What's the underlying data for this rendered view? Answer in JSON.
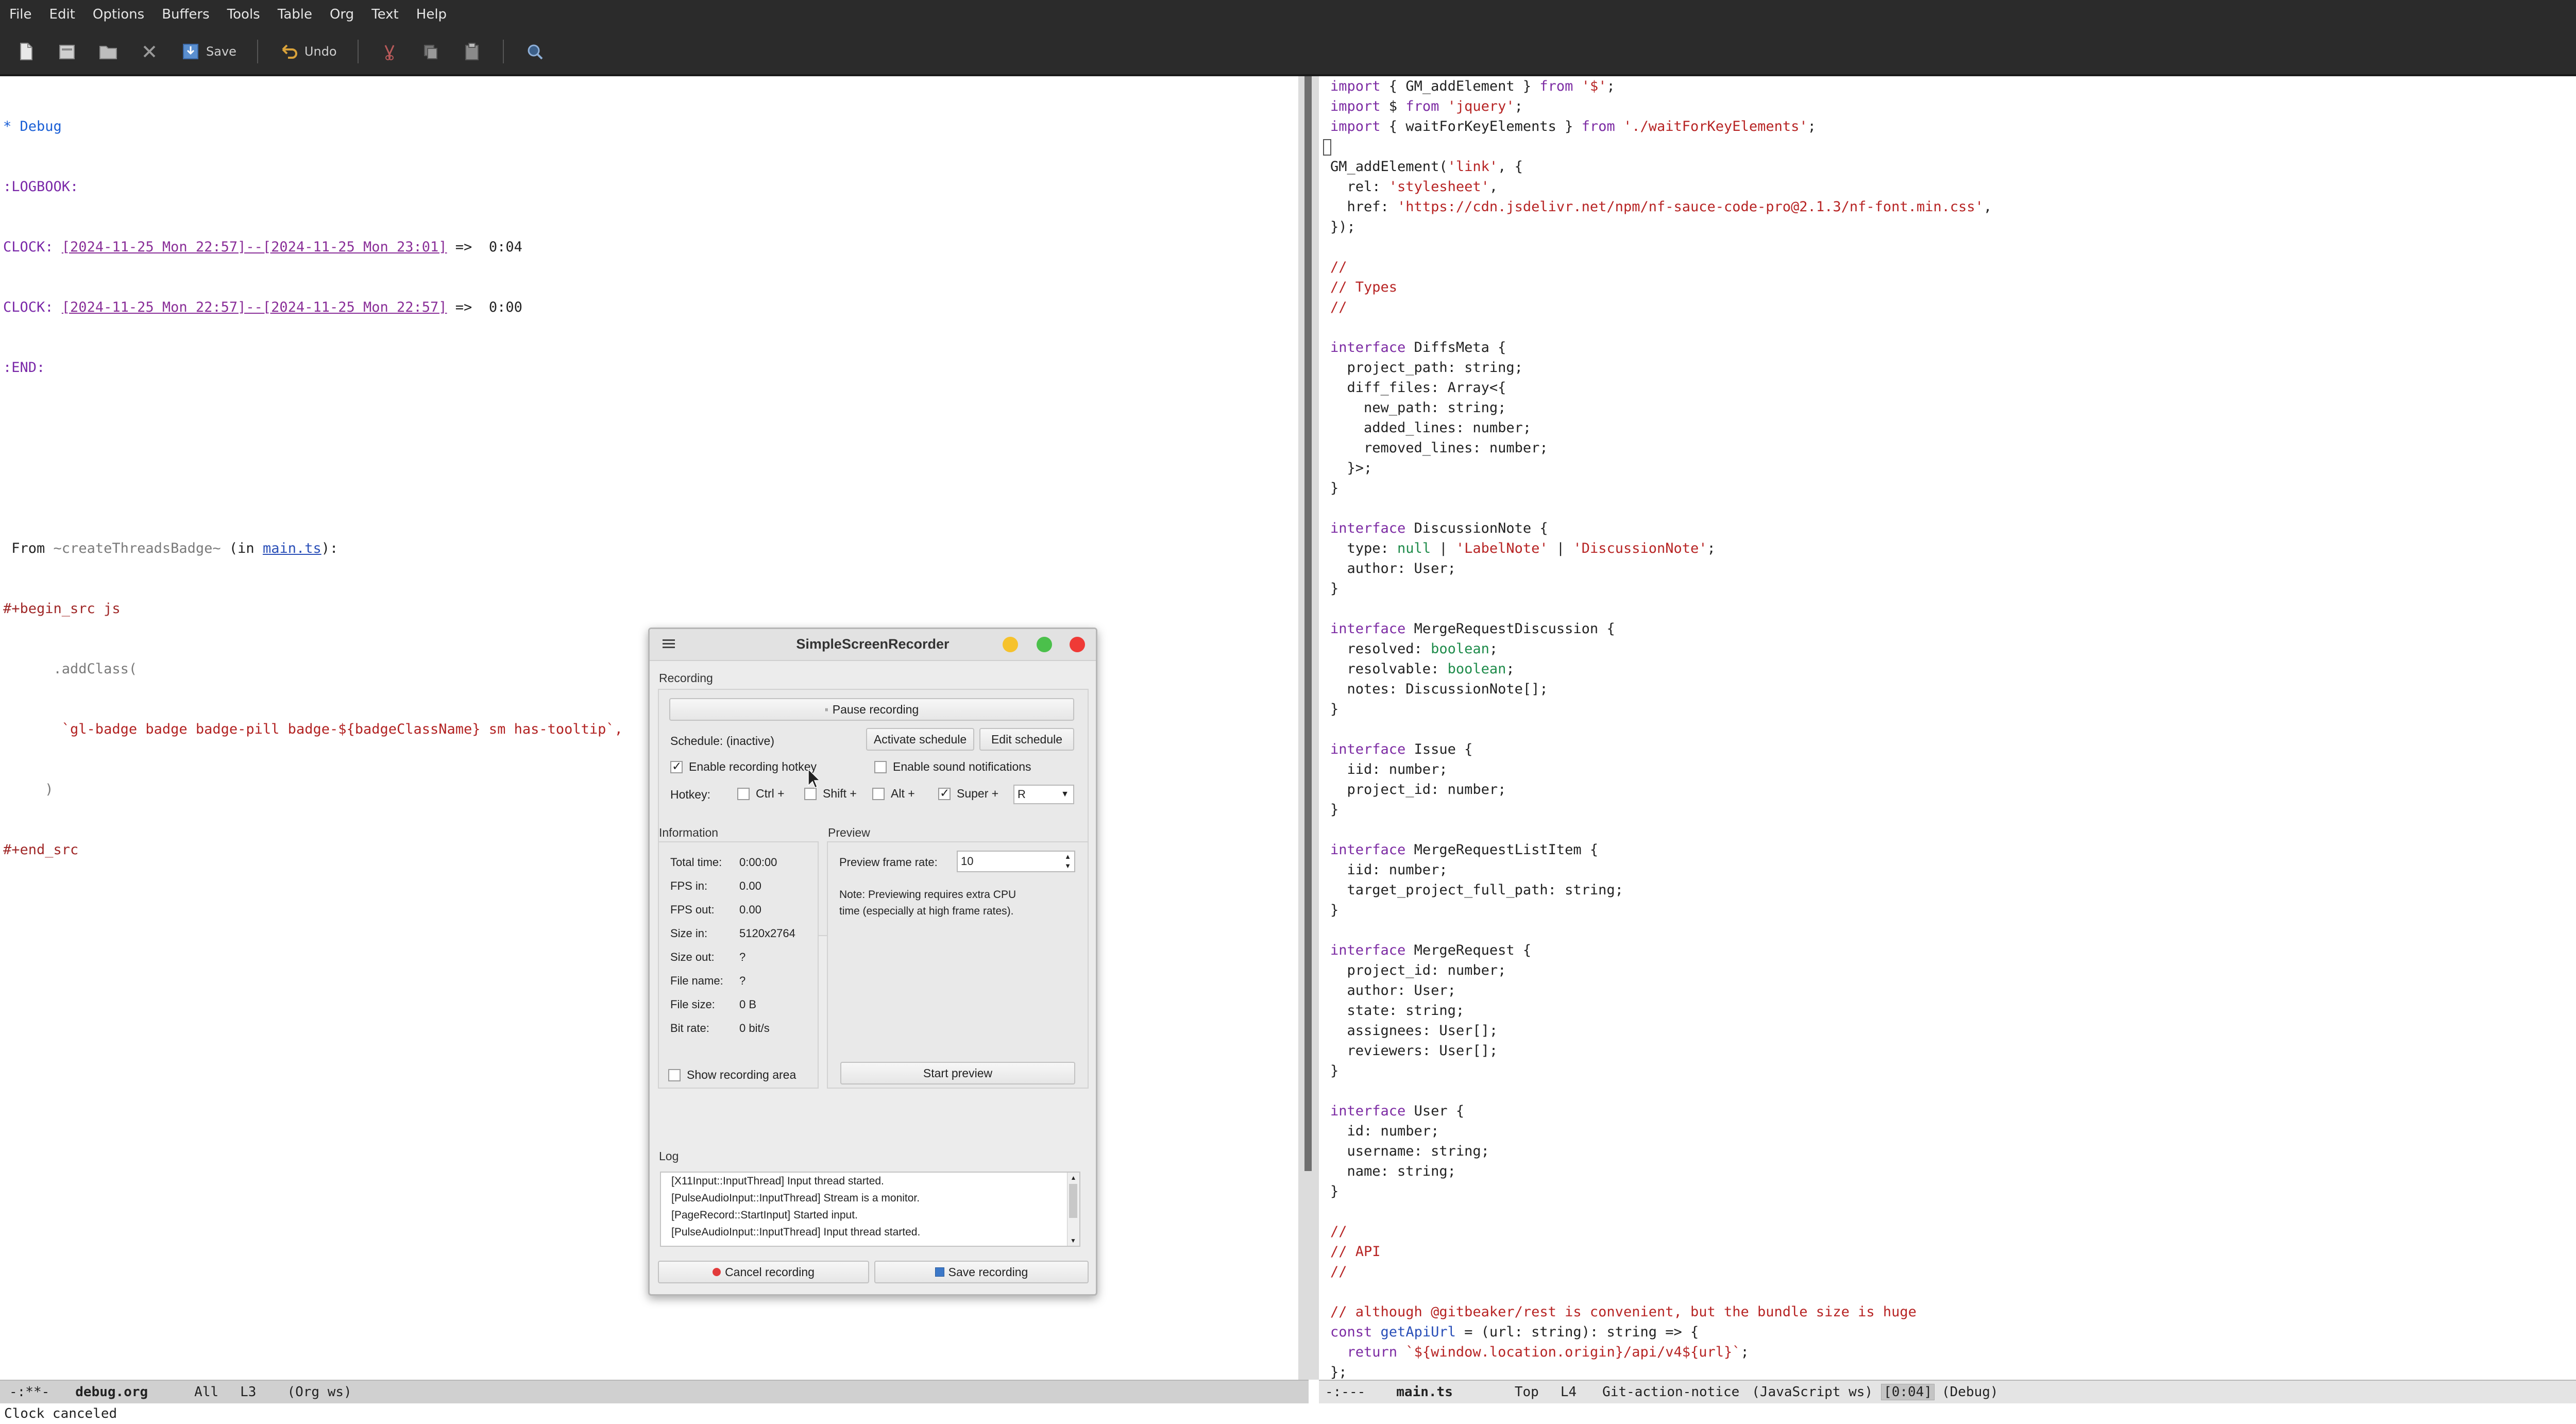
{
  "menubar": {
    "items": [
      "File",
      "Edit",
      "Options",
      "Buffers",
      "Tools",
      "Table",
      "Org",
      "Text",
      "Help"
    ]
  },
  "toolbar": {
    "save_label": "Save",
    "undo_label": "Undo",
    "icons": [
      "new-file-icon",
      "open-file-icon",
      "open-directory-icon",
      "close-icon",
      "save-icon",
      "undo-icon",
      "cut-icon",
      "copy-icon",
      "paste-icon",
      "search-icon"
    ]
  },
  "left_buffer": {
    "lines": {
      "l1": "* Debug",
      "l2": ":LOGBOOK:",
      "l3_pre": "CLOCK: ",
      "l3_ts": "[2024-11-25 Mon 22:57]--[2024-11-25 Mon 23:01]",
      "l3_post": " =>  0:04",
      "l4_pre": "CLOCK: ",
      "l4_ts": "[2024-11-25 Mon 22:57]--[2024-11-25 Mon 22:57]",
      "l4_post": " =>  0:00",
      "l5": ":END:",
      "l8_a": " From ",
      "l8_b": "~createThreadsBadge~",
      "l8_c": " (in ",
      "l8_d": "main.ts",
      "l8_e": "):",
      "l9": "#+begin_src js",
      "l10": "      .addClass(",
      "l11": "       `gl-badge badge badge-pill badge-${badgeClassName} sm has-tooltip`,",
      "l12": "     )",
      "l13": "#+end_src"
    }
  },
  "right_buffer": {
    "lines": [
      [
        "k:import",
        " { GM_addElement } ",
        "k:from",
        " ",
        "s:'$'",
        ";"
      ],
      [
        "k:import",
        " $ ",
        "k:from",
        " ",
        "s:'jquery'",
        ";"
      ],
      [
        "k:import",
        " { waitForKeyElements } ",
        "k:from",
        " ",
        "s:'./waitForKeyElements'",
        ";"
      ],
      [
        ""
      ],
      [
        "GM_addElement(",
        "s:'link'",
        ", {"
      ],
      [
        "  rel: ",
        "s:'stylesheet'",
        ","
      ],
      [
        "  href: ",
        "s:'https://cdn.jsdelivr.net/npm/nf-sauce-code-pro@2.1.3/nf-font.min.css'",
        ","
      ],
      [
        "});"
      ],
      [
        ""
      ],
      [
        "c://"
      ],
      [
        "c:// Types"
      ],
      [
        "c://"
      ],
      [
        ""
      ],
      [
        "k:interface",
        " DiffsMeta {"
      ],
      [
        "  project_path: string;"
      ],
      [
        "  diff_files: Array<{"
      ],
      [
        "    new_path: string;"
      ],
      [
        "    added_lines: number;"
      ],
      [
        "    removed_lines: number;"
      ],
      [
        "  }>;"
      ],
      [
        "}"
      ],
      [
        ""
      ],
      [
        "k:interface",
        " DiscussionNote {"
      ],
      [
        "  type: ",
        "t:null",
        " | ",
        "s:'LabelNote'",
        " | ",
        "s:'DiscussionNote'",
        ";"
      ],
      [
        "  author: User;"
      ],
      [
        "}"
      ],
      [
        ""
      ],
      [
        "k:interface",
        " MergeRequestDiscussion {"
      ],
      [
        "  resolved: ",
        "t:boolean",
        ";"
      ],
      [
        "  resolvable: ",
        "t:boolean",
        ";"
      ],
      [
        "  notes: DiscussionNote[];"
      ],
      [
        "}"
      ],
      [
        ""
      ],
      [
        "k:interface",
        " Issue {"
      ],
      [
        "  iid: number;"
      ],
      [
        "  project_id: number;"
      ],
      [
        "}"
      ],
      [
        ""
      ],
      [
        "k:interface",
        " MergeRequestListItem {"
      ],
      [
        "  iid: number;"
      ],
      [
        "  target_project_full_path: string;"
      ],
      [
        "}"
      ],
      [
        ""
      ],
      [
        "k:interface",
        " MergeRequest {"
      ],
      [
        "  project_id: number;"
      ],
      [
        "  author: User;"
      ],
      [
        "  state: string;"
      ],
      [
        "  assignees: User[];"
      ],
      [
        "  reviewers: User[];"
      ],
      [
        "}"
      ],
      [
        ""
      ],
      [
        "k:interface",
        " User {"
      ],
      [
        "  id: number;"
      ],
      [
        "  username: string;"
      ],
      [
        "  name: string;"
      ],
      [
        "}"
      ],
      [
        ""
      ],
      [
        "c://"
      ],
      [
        "c:// API"
      ],
      [
        "c://"
      ],
      [
        ""
      ],
      [
        "c:// although @gitbeaker/rest is convenient, but the bundle size is huge"
      ],
      [
        "k:const",
        " ",
        "f:getApiUrl",
        " = (url: string): string => {"
      ],
      [
        "  ",
        "k:return",
        " ",
        "s:`${window.location.origin}/api/v4${url}`",
        ";"
      ],
      [
        "};"
      ]
    ]
  },
  "modeline_left": {
    "status": "-:**-",
    "buffer": "debug.org",
    "position": "All",
    "line": "L3",
    "mode": "(Org ws)"
  },
  "modeline_right": {
    "status": "-:---",
    "buffer": "main.ts",
    "position": "Top",
    "line": "L4",
    "extra": "Git-action-notice",
    "mode": "(JavaScript ws)",
    "clock": "[0:04]",
    "task": "(Debug)"
  },
  "echo_area": "Clock canceled",
  "dialog": {
    "title": "SimpleScreenRecorder",
    "recording_label": "Recording",
    "pause_button": "Pause recording",
    "schedule_label": "Schedule: (inactive)",
    "activate_schedule": "Activate schedule",
    "edit_schedule": "Edit schedule",
    "enable_hotkey": "Enable recording hotkey",
    "enable_sound": "Enable sound notifications",
    "hotkey_label": "Hotkey:",
    "ctrl": "Ctrl +",
    "shift": "Shift +",
    "alt": "Alt +",
    "super": "Super +",
    "hotkey_key": "R",
    "information_label": "Information",
    "preview_label": "Preview",
    "info": {
      "total_time_label": "Total time:",
      "total_time": "0:00:00",
      "fps_in_label": "FPS in:",
      "fps_in": "0.00",
      "fps_out_label": "FPS out:",
      "fps_out": "0.00",
      "size_in_label": "Size in:",
      "size_in": "5120x2764",
      "size_out_label": "Size out:",
      "size_out": "?",
      "file_name_label": "File name:",
      "file_name": "?",
      "file_size_label": "File size:",
      "file_size": "0 B",
      "bit_rate_label": "Bit rate:",
      "bit_rate": "0 bit/s"
    },
    "preview_frame_rate_label": "Preview frame rate:",
    "preview_frame_rate": "10",
    "preview_note_1": "Note: Previewing requires extra CPU",
    "preview_note_2": "time (especially at high frame rates).",
    "show_recording_area": "Show recording area",
    "start_preview": "Start preview",
    "log_label": "Log",
    "log_lines": [
      "[X11Input::InputThread] Input thread started.",
      "[PulseAudioInput::InputThread] Stream is a monitor.",
      "[PageRecord::StartInput] Started input.",
      "[PulseAudioInput::InputThread] Input thread started."
    ],
    "cancel_recording": "Cancel recording",
    "save_recording": "Save recording"
  }
}
